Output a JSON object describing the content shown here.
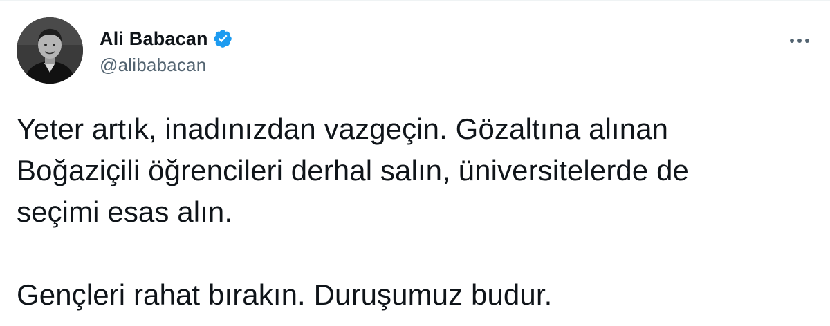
{
  "author": {
    "display_name": "Ali Babacan",
    "handle": "@alibabacan",
    "verified": true,
    "verified_icon": "verified-badge-icon",
    "verified_color": "#1d9bf0",
    "avatar_icon": "profile-photo-avatar"
  },
  "menu": {
    "icon": "more-horizontal-icon"
  },
  "tweet": {
    "paragraph_1": "Yeter artık, inadınızdan vazgeçin. Gözaltına alınan\nBoğaziçili öğrencileri derhal salın, üniversitelerde de\nseçimi esas alın.",
    "paragraph_2": "Gençleri rahat bırakın. Duruşumuz budur."
  },
  "colors": {
    "text_primary": "#0f1419",
    "text_secondary": "#536471",
    "background": "#ffffff"
  }
}
